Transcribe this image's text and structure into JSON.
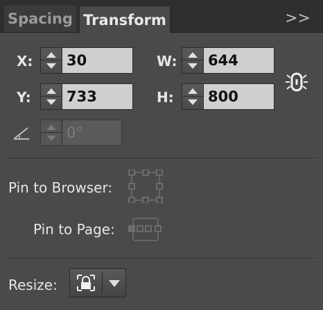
{
  "tabs": [
    {
      "label": "Spacing",
      "active": false
    },
    {
      "label": "Transform",
      "active": true
    }
  ],
  "overflow_icon": "double-chevron-right-icon",
  "overflow_text": ">>",
  "transform": {
    "x": {
      "label": "X:",
      "value": "30"
    },
    "y": {
      "label": "Y:",
      "value": "733"
    },
    "w": {
      "label": "W:",
      "value": "644"
    },
    "h": {
      "label": "H:",
      "value": "800"
    },
    "angle": {
      "value": "0°",
      "icon": "angle-icon"
    },
    "link_icon": "link-proportions-icon"
  },
  "pin": {
    "browser_label": "Pin to Browser:",
    "page_label": "Pin to Page:"
  },
  "resize": {
    "label": "Resize:",
    "icon": "lock-resize-icon"
  },
  "colors": {
    "panel_bg": "#4a4a4a",
    "tabbar_bg": "#2f2f2f",
    "field_bg": "#cfcfcf"
  }
}
